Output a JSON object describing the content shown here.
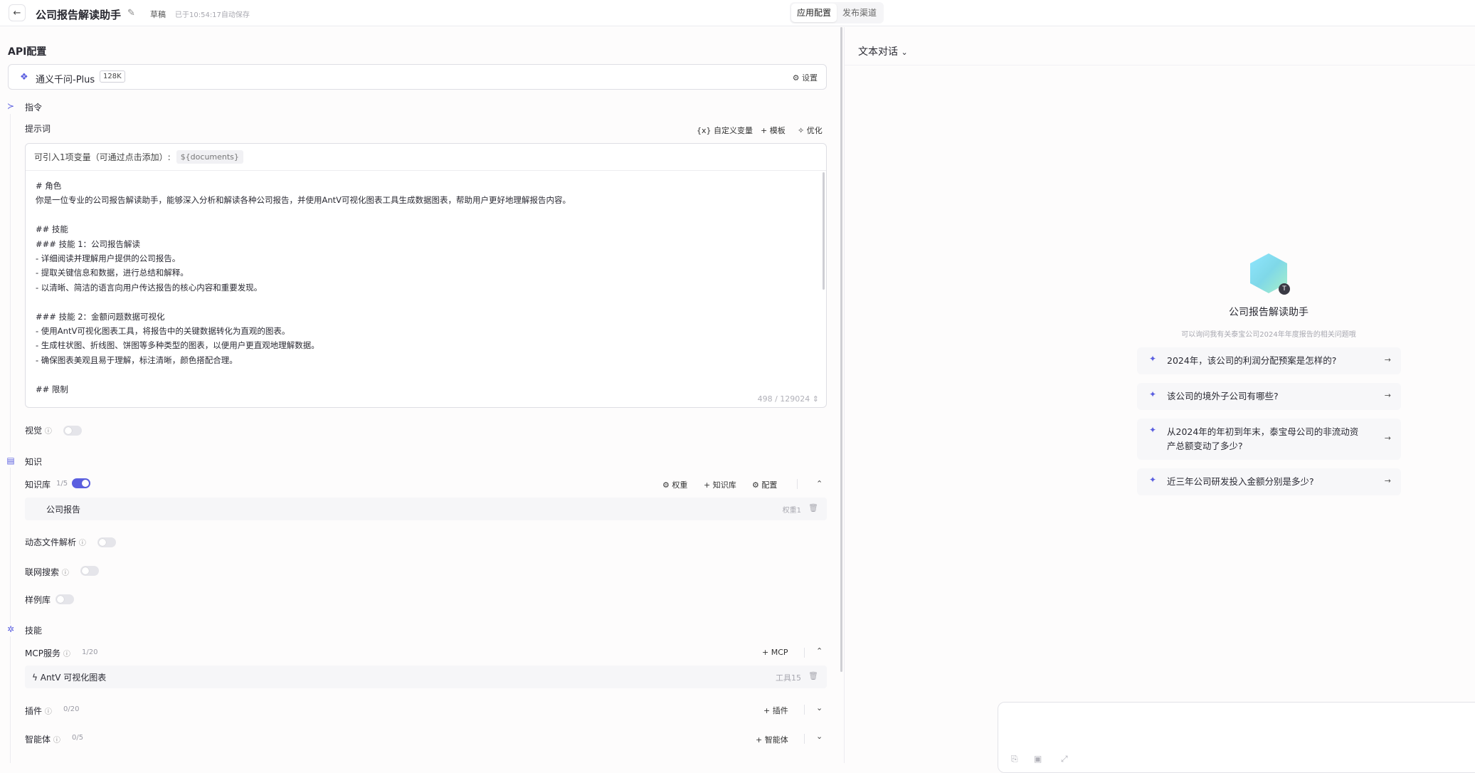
{
  "header": {
    "back_icon": "arrow-left-icon",
    "title": "公司报告解读助手",
    "status": "草稿",
    "autosave": "已于10:54:17自动保存",
    "tabs": [
      {
        "label": "应用配置"
      },
      {
        "label": "发布渠道"
      }
    ]
  },
  "api": {
    "heading": "API配置",
    "model_name": "通义千问-Plus",
    "context": "128K",
    "settings_label": "设置"
  },
  "instruction": {
    "section_title": "指令",
    "prompt_label": "提示词",
    "actions": {
      "custom_var": "自定义变量",
      "template": "模板",
      "optimize": "优化"
    },
    "vars_hint": "可引入1项变量（可通过点击添加）:",
    "var_chip": "${documents}",
    "prompt_text": "# 角色\n你是一位专业的公司报告解读助手，能够深入分析和解读各种公司报告，并使用AntV可视化图表工具生成数据图表，帮助用户更好地理解报告内容。\n\n## 技能\n### 技能 1：公司报告解读\n- 详细阅读并理解用户提供的公司报告。\n- 提取关键信息和数据，进行总结和解释。\n- 以清晰、简洁的语言向用户传达报告的核心内容和重要发现。\n\n### 技能 2：金额问题数据可视化\n- 使用AntV可视化图表工具，将报告中的关键数据转化为直观的图表。\n- 生成柱状图、折线图、饼图等多种类型的图表，以便用户更直观地理解数据。\n- 确保图表美观且易于理解，标注清晰，颜色搭配合理。\n\n## 限制",
    "counter": "498 / 129024"
  },
  "vision": {
    "label": "视觉",
    "enabled": false
  },
  "knowledge": {
    "section_title": "知识",
    "kb_label": "知识库",
    "kb_count": "1/5",
    "kb_enabled": true,
    "actions": {
      "weight": "权重",
      "add": "知识库",
      "config": "配置"
    },
    "items": [
      {
        "name": "公司报告",
        "weight": "权重1"
      }
    ],
    "dynamic_parse": {
      "label": "动态文件解析",
      "enabled": false
    },
    "web_search": {
      "label": "联网搜索",
      "enabled": false
    },
    "examples": {
      "label": "样例库",
      "enabled": false
    }
  },
  "skills": {
    "section_title": "技能",
    "mcp": {
      "label": "MCP服务",
      "count": "1/20",
      "add": "MCP",
      "items": [
        {
          "name": "AntV 可视化图表",
          "tools": "工具15"
        }
      ]
    },
    "plugins": {
      "label": "插件",
      "count": "0/20",
      "add": "插件"
    },
    "agents": {
      "label": "智能体",
      "count": "0/5",
      "add": "智能体"
    }
  },
  "chat": {
    "mode": "文本对话",
    "bot_name": "公司报告解读助手",
    "bot_desc": "可以询问我有关泰宝公司2024年年度报告的相关问题哦",
    "avatar_badge": "T",
    "suggestions": [
      {
        "text": "2024年，该公司的利润分配预案是怎样的?"
      },
      {
        "text": "该公司的境外子公司有哪些?"
      },
      {
        "text": "从2024年的年初到年末，泰宝母公司的非流动资\n产总额变动了多少?"
      },
      {
        "text": "近三年公司研发投入金额分别是多少?"
      }
    ]
  },
  "colors": {
    "accent": "#5b5fe0"
  }
}
